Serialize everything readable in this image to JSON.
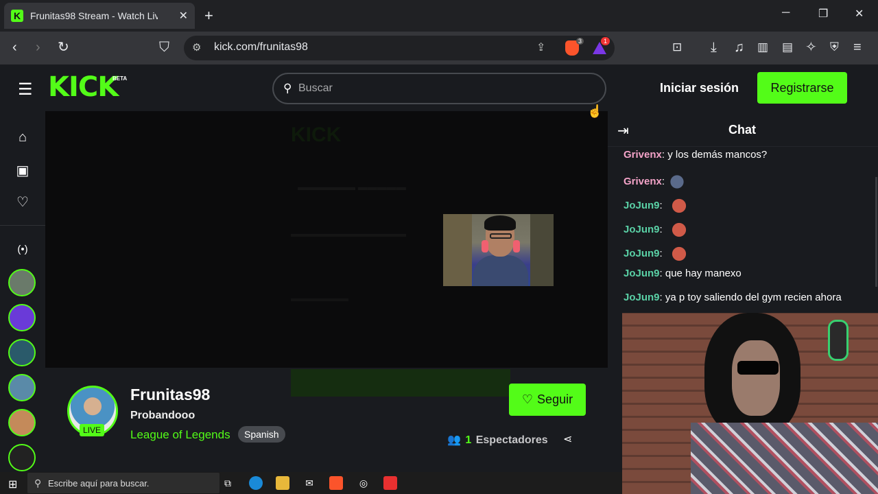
{
  "browser": {
    "tab_title": "Frunitas98 Stream - Watch Liv",
    "tab_favicon": "K",
    "close_tab": "✕",
    "new_tab": "+",
    "url": "kick.com/frunitas98",
    "brave_badge": "3",
    "rewards_badge": "1",
    "minimize": "─",
    "maximize": "❐",
    "close": "✕"
  },
  "header": {
    "logo": "KICK",
    "beta": "BETA",
    "search_placeholder": "Buscar",
    "login": "Iniciar sesión",
    "register": "Registrarse"
  },
  "stream": {
    "streamer": "Frunitas98",
    "title": "Probandooo",
    "category": "League of Legends",
    "language": "Spanish",
    "live_badge": "LIVE",
    "follow_label": "Seguir",
    "viewer_count": "1",
    "viewer_label": "Espectadores"
  },
  "chat": {
    "title": "Chat",
    "messages": [
      {
        "user": "Grivenx",
        "text": ": y los demás mancos?",
        "emote": null
      },
      {
        "user": "Grivenx",
        "text": ":",
        "emote": "bird"
      },
      {
        "user": "JoJun9",
        "text": ":",
        "emote": "flex"
      },
      {
        "user": "JoJun9",
        "text": ":",
        "emote": "flex"
      },
      {
        "user": "JoJun9",
        "text": ":",
        "emote": "flex"
      },
      {
        "user": "JoJun9",
        "text": ": que hay manexo",
        "emote": null
      },
      {
        "user": "JoJun9",
        "text": ": ya p toy saliendo del gym recien ahora",
        "emote": null
      }
    ]
  },
  "taskbar": {
    "search_placeholder": "Escribe aquí para buscar."
  },
  "colors": {
    "accent": "#53fc18",
    "username_pink": "#f3a3c8",
    "username_teal": "#5ad1a6"
  }
}
